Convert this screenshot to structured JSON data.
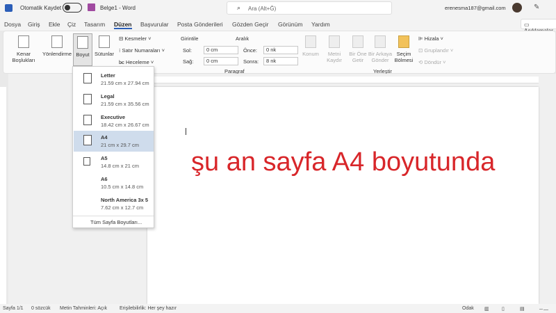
{
  "titlebar": {
    "autosave": "Otomatik Kaydet",
    "doc_title": "Belge1  -  Word",
    "search_placeholder": "Ara (Alt+Ğ)",
    "account": "erenesma187@gmail.com"
  },
  "tabs": [
    "Dosya",
    "Giriş",
    "Ekle",
    "Çiz",
    "Tasarım",
    "Düzen",
    "Başvurular",
    "Posta Gönderileri",
    "Gözden Geçir",
    "Görünüm",
    "Yardım"
  ],
  "comments_button": "Açıklamalar",
  "ribbon": {
    "margins": "Kenar Boşlukları",
    "orientation": "Yönlendirme",
    "size": "Boyut",
    "columns": "Sütunlar",
    "breaks": "Kesmeler",
    "line_numbers": "Satır Numaraları",
    "hyphenation": "Heceleme",
    "indent_label": "Girintile",
    "spacing_label": "Aralık",
    "left": "Sol:",
    "right": "Sağ:",
    "before": "Önce:",
    "after": "Sonra:",
    "left_val": "0 cm",
    "right_val": "0 cm",
    "before_val": "0 nk",
    "after_val": "8 nk",
    "paragraph_group": "Paragraf",
    "position": "Konum",
    "wrap": "Metni Kaydır",
    "forward": "Bir Öne Getir",
    "backward": "Bir Arkaya Gönder",
    "selection_pane": "Seçim Bölmesi",
    "align": "Hizala",
    "group": "Gruplandır",
    "rotate": "Döndür",
    "arrange_group": "Yerleştir"
  },
  "size_menu": {
    "items": [
      {
        "name": "Letter",
        "size": "21.59 cm x 27.94 cm"
      },
      {
        "name": "Legal",
        "size": "21.59 cm x 35.56 cm"
      },
      {
        "name": "Executive",
        "size": "18.42 cm x 26.67 cm"
      },
      {
        "name": "A4",
        "size": "21 cm x 29.7 cm",
        "selected": true
      },
      {
        "name": "A5",
        "size": "14.8 cm x 21 cm"
      },
      {
        "name": "A6",
        "size": "10.5 cm x 14.8 cm"
      },
      {
        "name": "North America 3x 5",
        "size": "7.62 cm x 12.7 cm"
      }
    ],
    "more": "Tüm Sayfa Boyutları..."
  },
  "document": {
    "overlay_text": "şu an sayfa A4 boyutunda"
  },
  "status": {
    "page": "Sayfa 1/1",
    "words": "0 sözcük",
    "predictions": "Metin Tahminleri: Açık",
    "accessibility": "Erişilebilirlik: Her şey hazır",
    "focus": "Odak"
  }
}
